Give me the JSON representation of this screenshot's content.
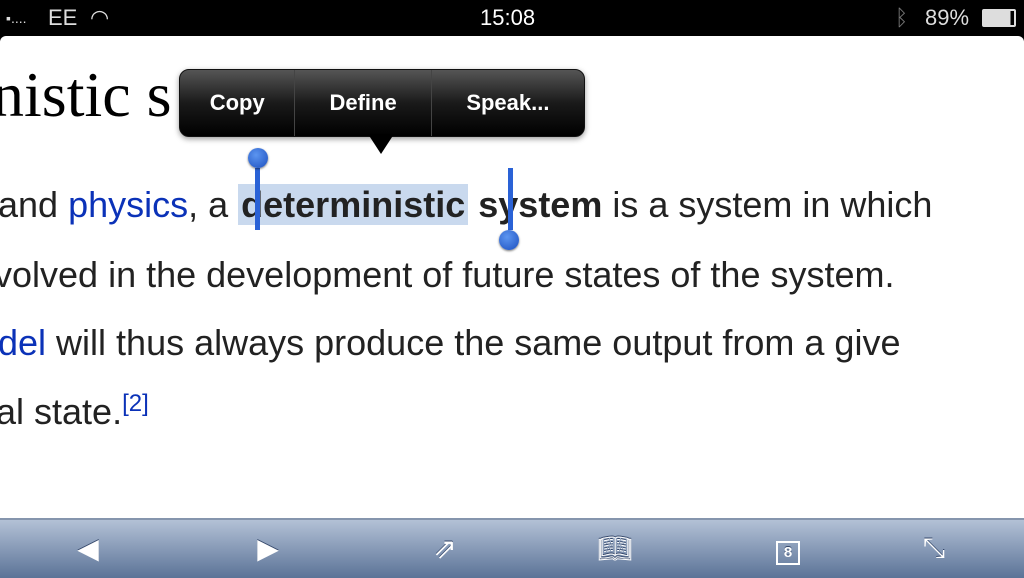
{
  "status": {
    "carrier": "EE",
    "signal": "signal-dots",
    "time": "15:08",
    "battery": "89%"
  },
  "article": {
    "title_fragment": "nistic s",
    "line1": {
      "pre": "and ",
      "link": "physics",
      "mid": ", a ",
      "selected": "deterministic",
      "bold": "system",
      "post": " is a system in which"
    },
    "line2": "volved in the development of future states of the system.",
    "line3": {
      "link": "del",
      "post": " will thus always produce the same output from a give"
    },
    "line4": {
      "text": "al state.",
      "ref": "[2]"
    }
  },
  "popup": {
    "items": [
      "Copy",
      "Define",
      "Speak..."
    ]
  },
  "toolbar": {
    "tabs_count": "8"
  },
  "colors": {
    "link": "#0b32b8",
    "selection": "#c9d9ee",
    "handle": "#2a62d6"
  }
}
